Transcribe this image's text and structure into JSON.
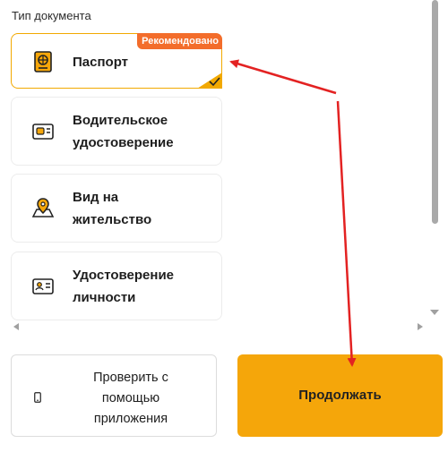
{
  "section_title": "Тип документа",
  "documents": [
    {
      "label": "Паспорт",
      "icon": "passport-icon",
      "selected": true,
      "badge": "Рекомендовано"
    },
    {
      "label": "Водительское удостоверение",
      "icon": "driver-license-icon",
      "selected": false
    },
    {
      "label": "Вид на жительство",
      "icon": "residence-permit-icon",
      "selected": false
    },
    {
      "label": "Удостоверение личности",
      "icon": "id-card-icon",
      "selected": false
    }
  ],
  "buttons": {
    "verify_app": "Проверить с помощью приложения",
    "continue": "Продолжать"
  },
  "colors": {
    "accent": "#f5a60a",
    "selected_border": "#f2a900",
    "badge": "#f36d2b",
    "annotation_arrow": "#e32222"
  }
}
